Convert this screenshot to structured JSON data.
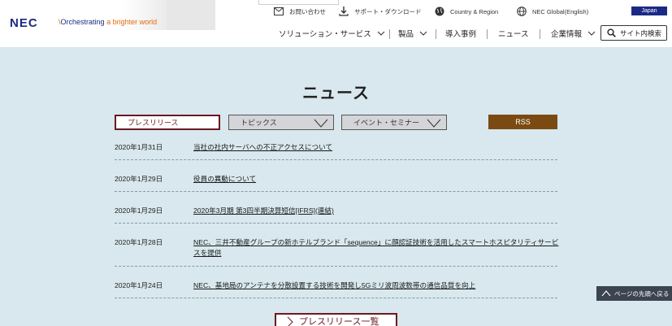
{
  "header": {
    "logo": "NEC",
    "tagline_prefix": "Orchestrating",
    "tagline_accent": "a brighter world",
    "utility": [
      {
        "label": "お問い合わせ",
        "icon": "mail-icon"
      },
      {
        "label": "サポート・ダウンロード",
        "icon": "download-icon"
      },
      {
        "label": "Country & Region",
        "icon": "globe-icon"
      },
      {
        "label": "NEC Global(English)",
        "icon": "globe-icon"
      }
    ],
    "japan_label": "Japan",
    "nav": [
      {
        "label": "ソリューション・サービス"
      },
      {
        "label": "製品"
      },
      {
        "label": "導入事例"
      },
      {
        "label": "ニュース"
      },
      {
        "label": "企業情報"
      }
    ],
    "search_label": "サイト内検索"
  },
  "main": {
    "title": "ニュース",
    "tabs": [
      {
        "label": "プレスリリース"
      },
      {
        "label": "トピックス"
      },
      {
        "label": "イベント・セミナー"
      }
    ],
    "rss_label": "RSS",
    "news": [
      {
        "date": "2020年1月31日",
        "title": "当社の社内サーバへの不正アクセスについて"
      },
      {
        "date": "2020年1月29日",
        "title": "役員の異動について"
      },
      {
        "date": "2020年1月29日",
        "title": "2020年3月期 第3四半期決算短信[IFRS](連結)"
      },
      {
        "date": "2020年1月28日",
        "title": "NEC、三井不動産グループの新ホテルブランド「sequence」に顔認証技術を活用したスマートホスピタリティサービスを提供"
      },
      {
        "date": "2020年1月24日",
        "title": "NEC、基地局のアンテナを分散設置する技術を開発し5Gミリ波周波数帯の通信品質を向上"
      }
    ],
    "press_list_label": "プレスリリース一覧",
    "page_top_label": "ページの先頭へ戻る"
  },
  "colors": {
    "brand_blue": "#1a2a84",
    "accent_orange": "#e36a0a",
    "maroon": "#6a1a22",
    "rss_brown": "#7a4a12",
    "background": "#d8e8ee"
  }
}
